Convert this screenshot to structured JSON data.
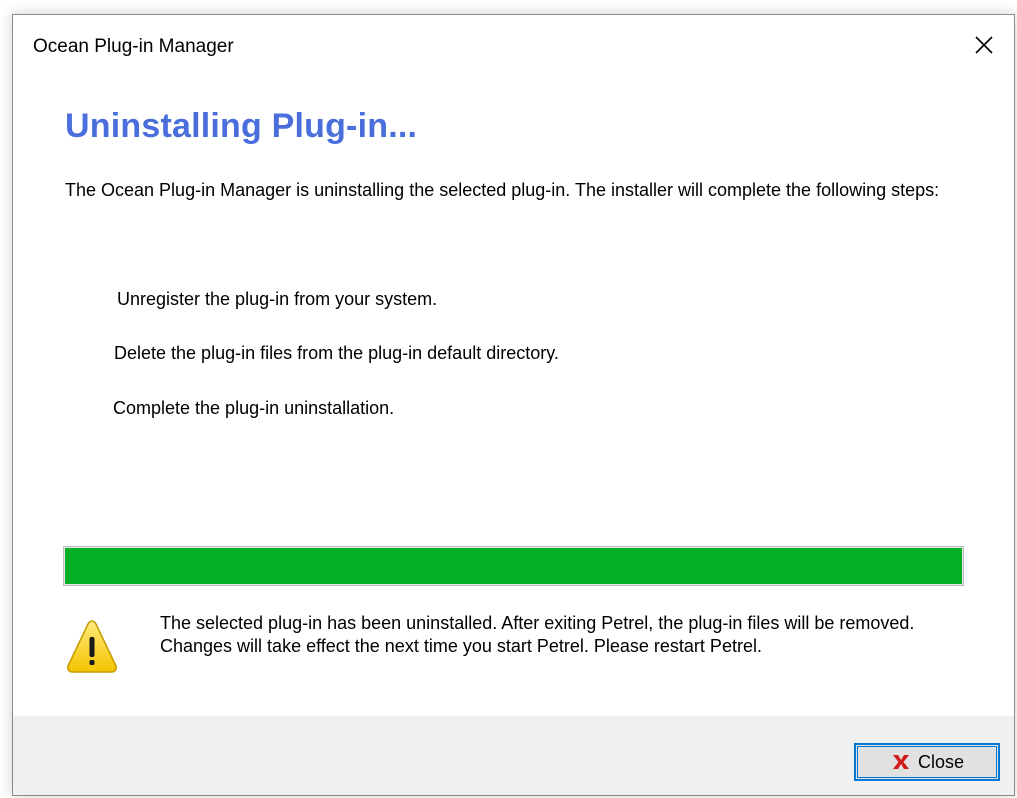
{
  "window": {
    "title": "Ocean Plug-in Manager"
  },
  "content": {
    "heading": "Uninstalling Plug-in...",
    "description": "The Ocean Plug-in Manager is uninstalling the selected plug-in. The installer will complete the following steps:",
    "steps": [
      "Unregister the plug-in from your system.",
      "Delete the plug-in files from the plug-in default directory.",
      "Complete the plug-in uninstallation."
    ]
  },
  "progress": {
    "value": 1.0,
    "color": "#06b025"
  },
  "warning": {
    "icon": "warning-icon",
    "text": "The selected plug-in has been uninstalled. After exiting Petrel, the plug-in files will be removed. Changes will take effect the next time you start Petrel. Please restart Petrel."
  },
  "footer": {
    "close_label": "Close",
    "close_icon": "red-x-icon"
  },
  "colors": {
    "heading": "#4a6fdc",
    "accent": "#0078d7"
  }
}
